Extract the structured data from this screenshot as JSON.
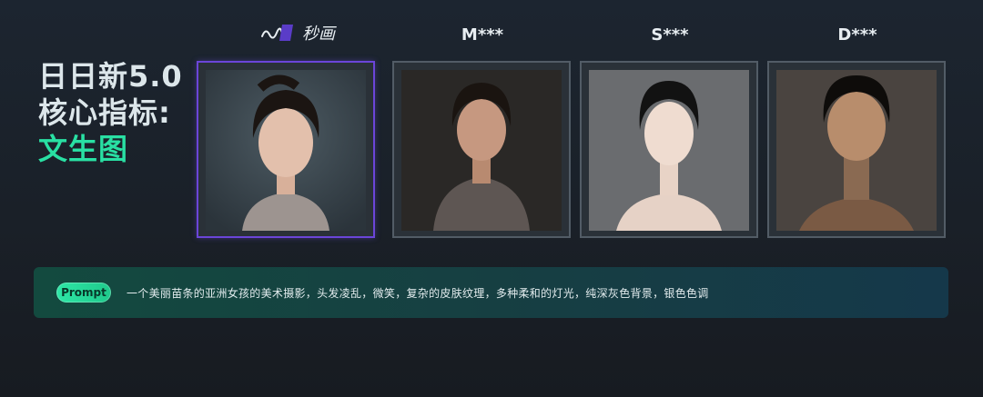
{
  "headline": {
    "line1": "日日新5.0",
    "line2": "核心指标:",
    "line3": "文生图"
  },
  "columns": [
    {
      "title": "秒画",
      "logo": "miaohua-logo-icon",
      "selected": true
    },
    {
      "title": "M***",
      "selected": false
    },
    {
      "title": "S***",
      "selected": false
    },
    {
      "title": "D***",
      "selected": false
    }
  ],
  "prompt": {
    "label": "Prompt",
    "text": "一个美丽苗条的亚洲女孩的美术摄影，头发凌乱，微笑，复杂的皮肤纹理，多种柔和的灯光，纯深灰色背景，银色色调"
  },
  "colors": {
    "accent_green": "#29e0a3",
    "selected_border": "#6b45d9",
    "logo_purple": "#5a3cc8"
  }
}
